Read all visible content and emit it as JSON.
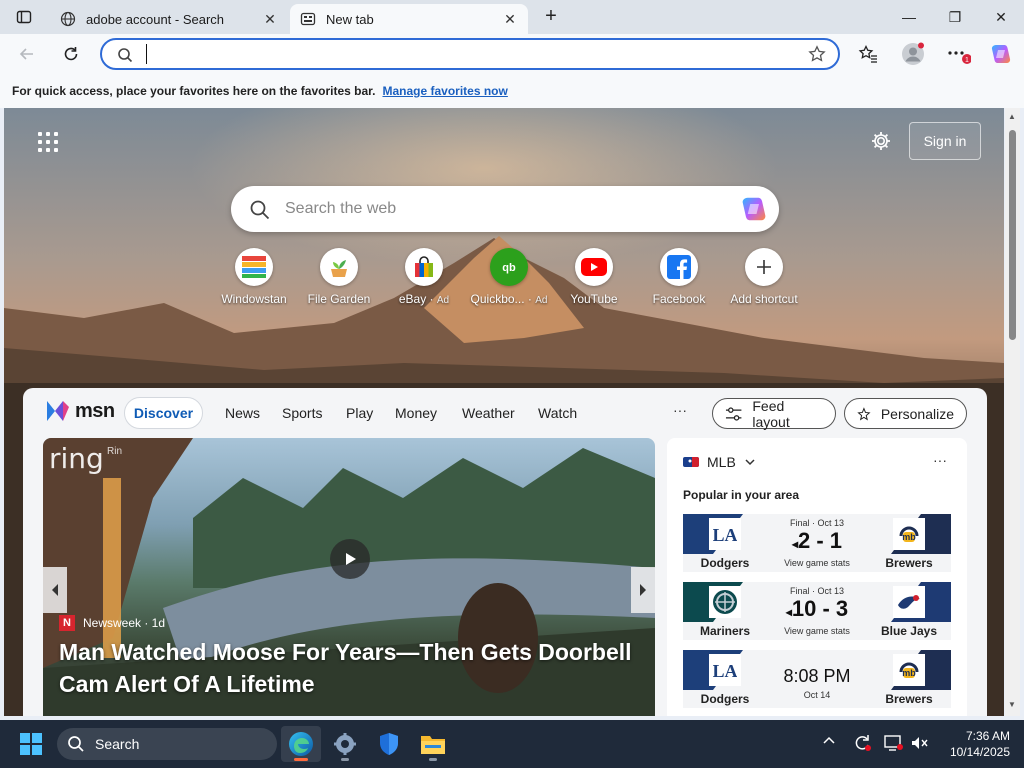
{
  "tabs": [
    {
      "title": "adobe account - Search",
      "close": "✕"
    },
    {
      "title": "New tab",
      "close": "✕"
    }
  ],
  "new_tab_symbol": "+",
  "window_controls": {
    "minimize": "—",
    "maximize": "❐",
    "close": "✕"
  },
  "address_bar": {
    "value": "",
    "placeholder": ""
  },
  "favorites_bar": {
    "message": "For quick access, place your favorites here on the favorites bar.",
    "link": "Manage favorites now"
  },
  "newtab": {
    "sign_in": "Sign in",
    "search_placeholder": "Search the web",
    "shortcuts": [
      {
        "label": "Windowstan",
        "ad": ""
      },
      {
        "label": "File Garden",
        "ad": ""
      },
      {
        "label": "eBay",
        "ad": "Ad"
      },
      {
        "label": "Quickbo...",
        "ad": "Ad"
      },
      {
        "label": "YouTube",
        "ad": ""
      },
      {
        "label": "Facebook",
        "ad": ""
      },
      {
        "label": "Add shortcut",
        "ad": ""
      }
    ]
  },
  "feed": {
    "brand": "msn",
    "nav": [
      "Discover",
      "News",
      "Sports",
      "Play",
      "Money",
      "Weather",
      "Watch"
    ],
    "more": "···",
    "feed_layout": "Feed layout",
    "personalize": "Personalize",
    "hero": {
      "watermark": "ring",
      "watermark_sub": "Rin",
      "source": "Newsweek · 1d",
      "source_initial": "N",
      "title": "Man Watched Moose For Years—Then Gets Doorbell Cam Alert Of A Lifetime"
    },
    "sports": {
      "league": "MLB",
      "subtitle": "Popular in your area",
      "more": "···",
      "games": [
        {
          "status": "Final · Oct 13",
          "score": "2 - 1",
          "extra": "View game stats",
          "home": "Dodgers",
          "away": "Brewers",
          "home_color": "#1d3f7a",
          "away_color": "#1e2e52"
        },
        {
          "status": "Final · Oct 13",
          "score": "10 - 3",
          "extra": "View game stats",
          "home": "Mariners",
          "away": "Blue Jays",
          "home_color": "#0c4a4e",
          "away_color": "#1e3a73"
        },
        {
          "status": "",
          "score": "8:08 PM",
          "extra": "Oct 14",
          "home": "Dodgers",
          "away": "Brewers",
          "home_color": "#1d3f7a",
          "away_color": "#1e2e52"
        }
      ]
    }
  },
  "taskbar": {
    "search_label": "Search",
    "time": "7:36 AM",
    "date": "10/14/2025"
  }
}
